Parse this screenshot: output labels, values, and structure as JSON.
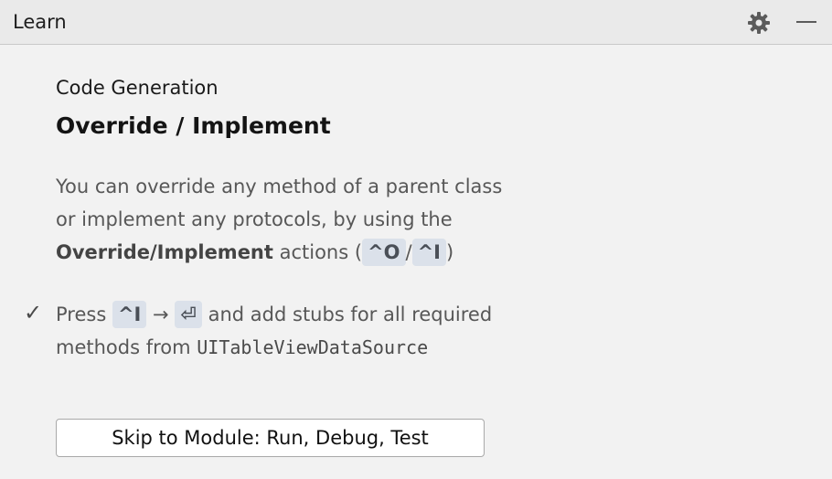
{
  "header": {
    "title": "Learn",
    "icons": {
      "settings": "gear-icon",
      "minimize": "minimize-icon"
    }
  },
  "lesson": {
    "module_name": "Code Generation",
    "title": "Override / Implement",
    "description": {
      "line1": "You can override any method of a parent class",
      "line2": "or implement any protocols, by using the",
      "bold_action": "Override/Implement",
      "actions_text": " actions (",
      "shortcut_override": "^O",
      "separator": "/",
      "shortcut_implement": "^I",
      "close_paren": ")"
    },
    "step": {
      "status": "✓",
      "press": "Press ",
      "key1": "^I",
      "arrow": " → ",
      "key2": "⏎",
      "rest": " and add stubs for all required",
      "line2": "methods from ",
      "class_name": "UITableViewDataSource"
    }
  },
  "skip_button": {
    "label": "Skip to Module: Run, Debug, Test"
  },
  "colors": {
    "background": "#f2f2f2",
    "header": "#eaeaea",
    "shortcut_bg": "#dbe1ea"
  }
}
